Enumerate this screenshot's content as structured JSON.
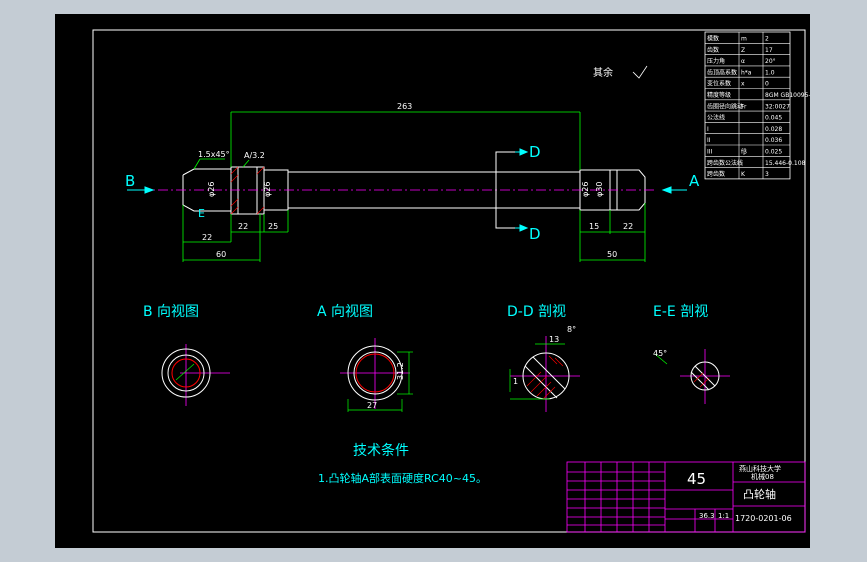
{
  "colors": {
    "background": "#000000",
    "frame": "#ffffff",
    "part": "#ffffff",
    "dimension": "#00ff00",
    "centerline": "#ff00ff",
    "section": "#00ffff",
    "hatch": "#ff0000",
    "text_cn": "#00ffff",
    "title_lines": "#ff00ff"
  },
  "drawing": {
    "dim_total": "263",
    "dim_bevel": "1.5x45°",
    "dim_left": [
      "22",
      "22",
      "25"
    ],
    "dim_left_total": "60",
    "dim_right": [
      "15",
      "22"
    ],
    "dim_right_total": "50",
    "diameters": [
      "φ26",
      "φ26",
      "φ26",
      "φ30"
    ],
    "roughness_top": "其余",
    "roughness_mark": "A/3.2",
    "section_labels": {
      "b": "B",
      "a": "A",
      "d_top": "D",
      "d_bottom": "D"
    }
  },
  "views": {
    "b_view": "B 向视图",
    "a_view": "A 向视图",
    "dd_view": "D-D 剖视",
    "ee_view": "E-E 剖视",
    "a_dims": [
      "31.2",
      "27"
    ],
    "dd_dims": [
      "13",
      "1",
      "8°"
    ],
    "ee_dims": [
      "45°"
    ]
  },
  "tech": {
    "heading": "技术条件",
    "note": "1.凸轮轴A部表面硬度RC40~45。"
  },
  "params_table": {
    "rows": [
      [
        "模数",
        "m",
        "2"
      ],
      [
        "齿数",
        "Z",
        "17"
      ],
      [
        "压力角",
        "α",
        "20°"
      ],
      [
        "齿顶高系数",
        "h*a",
        "1.0"
      ],
      [
        "变位系数",
        "x",
        "0"
      ],
      [
        "精度等级",
        "",
        "8GM GB10095-88"
      ],
      [
        "齿圈径向跳动",
        "Fr",
        "32:0027"
      ],
      [
        "公法线",
        "",
        "0.045"
      ],
      [
        "I",
        "",
        "0.028"
      ],
      [
        "II",
        "",
        "0.036"
      ],
      [
        "III",
        "fβ",
        "0.025"
      ],
      [
        "跨齿数公法线",
        "",
        "15.446-0.108"
      ],
      [
        "跨齿数",
        "K",
        "3"
      ]
    ]
  },
  "title_block": {
    "scale": "45",
    "school": "燕山科技大学",
    "class": "机械08",
    "part_name": "凸轮轴",
    "drawing_no": "1720-0201-06",
    "sheet": "36.3",
    "sheet_total": "1:1"
  }
}
